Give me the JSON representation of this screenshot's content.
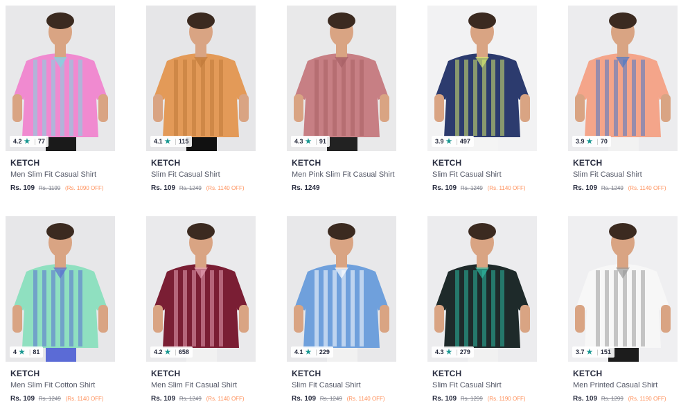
{
  "products": [
    {
      "brand": "KETCH",
      "name": "Men Slim Fit Casual Shirt",
      "price": "Rs. 109",
      "mrp": "Rs. 1199",
      "off": "(Rs. 1090 OFF)",
      "rating": "4.2",
      "count": "77",
      "colors": {
        "bg": "#e8e8ea",
        "shirt": "#f08ad0",
        "accent": "#7fd7e0",
        "skin": "#d9a483",
        "pants": "#1a1a1a"
      }
    },
    {
      "brand": "KETCH",
      "name": "Slim Fit Casual Shirt",
      "price": "Rs. 109",
      "mrp": "Rs. 1249",
      "off": "(Rs. 1140 OFF)",
      "rating": "4.1",
      "count": "115",
      "colors": {
        "bg": "#e6e6e8",
        "shirt": "#e39a58",
        "accent": "#c07a3a",
        "skin": "#d9a483",
        "pants": "#111111"
      }
    },
    {
      "brand": "KETCH",
      "name": "Men Pink Slim Fit Casual Shirt",
      "price": "Rs. 1249",
      "mrp": "",
      "off": "",
      "rating": "4.3",
      "count": "91",
      "colors": {
        "bg": "#e9e9ea",
        "shirt": "#c77f84",
        "accent": "#a76065",
        "skin": "#d9a483",
        "pants": "#222222"
      }
    },
    {
      "brand": "KETCH",
      "name": "Slim Fit Casual Shirt",
      "price": "Rs. 109",
      "mrp": "Rs. 1249",
      "off": "(Rs. 1140 OFF)",
      "rating": "3.9",
      "count": "497",
      "colors": {
        "bg": "#f2f2f3",
        "shirt": "#2c3b6e",
        "accent": "#d7e870",
        "skin": "#d9a483",
        "pants": "#f4f4f4"
      }
    },
    {
      "brand": "KETCH",
      "name": "Slim Fit Casual Shirt",
      "price": "Rs. 109",
      "mrp": "Rs. 1249",
      "off": "(Rs. 1140 OFF)",
      "rating": "3.9",
      "count": "70",
      "colors": {
        "bg": "#ececee",
        "shirt": "#f4a58a",
        "accent": "#4a78c8",
        "skin": "#d9a483",
        "pants": "#f2f2f2"
      }
    },
    {
      "brand": "KETCH",
      "name": "Men Slim Fit Cotton Shirt",
      "price": "Rs. 109",
      "mrp": "Rs. 1249",
      "off": "(Rs. 1140 OFF)",
      "rating": "4",
      "count": "81",
      "colors": {
        "bg": "#e7e7e9",
        "shirt": "#8fe0c0",
        "accent": "#5a6fd0",
        "skin": "#d9a483",
        "pants": "#5b6bd6"
      }
    },
    {
      "brand": "KETCH",
      "name": "Men Slim Fit Casual Shirt",
      "price": "Rs. 109",
      "mrp": "Rs. 1249",
      "off": "(Rs. 1140 OFF)",
      "rating": "4.2",
      "count": "658",
      "colors": {
        "bg": "#eaeaec",
        "shirt": "#7a1e34",
        "accent": "#e6a0b4",
        "skin": "#d9a483",
        "pants": "#f1f1f1"
      }
    },
    {
      "brand": "KETCH",
      "name": "Slim Fit Casual Shirt",
      "price": "Rs. 109",
      "mrp": "Rs. 1249",
      "off": "(Rs. 1140 OFF)",
      "rating": "4.1",
      "count": "229",
      "colors": {
        "bg": "#e8e8ea",
        "shirt": "#6fa0dc",
        "accent": "#ffffff",
        "skin": "#d9a483",
        "pants": "#f1f1f1"
      }
    },
    {
      "brand": "KETCH",
      "name": "Slim Fit Casual Shirt",
      "price": "Rs. 109",
      "mrp": "Rs. 1299",
      "off": "(Rs. 1190 OFF)",
      "rating": "4.3",
      "count": "279",
      "colors": {
        "bg": "#ececee",
        "shirt": "#1e2a2a",
        "accent": "#2cb8a0",
        "skin": "#d9a483",
        "pants": "#f1f1f1"
      }
    },
    {
      "brand": "KETCH",
      "name": "Men Printed Casual Shirt",
      "price": "Rs. 109",
      "mrp": "Rs. 1299",
      "off": "(Rs. 1190 OFF)",
      "rating": "3.7",
      "count": "151",
      "colors": {
        "bg": "#efeff1",
        "shirt": "#f7f7f7",
        "accent": "#9a9a9a",
        "skin": "#d9a483",
        "pants": "#1c1c1c"
      }
    }
  ]
}
